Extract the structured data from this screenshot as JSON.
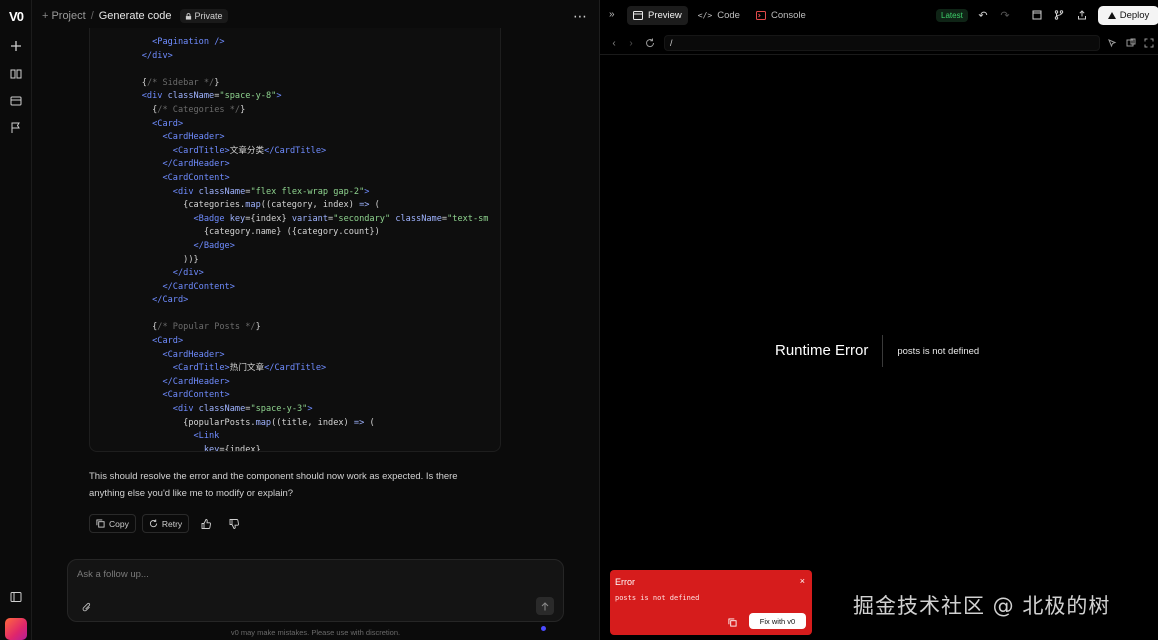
{
  "rail": {
    "logo": "V0",
    "icons": [
      "plus-icon",
      "book-icon",
      "folder-icon",
      "flag-icon",
      "sidebar-icon"
    ]
  },
  "header": {
    "project": "Project",
    "separator": "/",
    "title": "Generate code",
    "privacy": "Private",
    "more": "⋯"
  },
  "code_lines": [
    [
      [
        "            ",
        ""
      ],
      [
        "<",
        "tg"
      ],
      [
        "Pagination",
        "tg"
      ],
      [
        " />",
        "tg"
      ]
    ],
    [
      [
        "          ",
        ""
      ],
      [
        "</div>",
        "tg"
      ]
    ],
    [
      [
        "",
        ""
      ]
    ],
    [
      [
        "          ",
        ""
      ],
      [
        "{",
        ""
      ],
      [
        "/* Sidebar */",
        "cm"
      ],
      [
        "}",
        ""
      ]
    ],
    [
      [
        "          ",
        ""
      ],
      [
        "<div ",
        "tg"
      ],
      [
        "className",
        "at"
      ],
      [
        "=",
        ""
      ],
      [
        "\"space-y-8\"",
        "st"
      ],
      [
        ">",
        "tg"
      ]
    ],
    [
      [
        "            ",
        ""
      ],
      [
        "{",
        ""
      ],
      [
        "/* Categories */",
        "cm"
      ],
      [
        "}",
        ""
      ]
    ],
    [
      [
        "            ",
        ""
      ],
      [
        "<Card>",
        "tg"
      ]
    ],
    [
      [
        "              ",
        ""
      ],
      [
        "<CardHeader>",
        "tg"
      ]
    ],
    [
      [
        "                ",
        ""
      ],
      [
        "<CardTitle>",
        "tg"
      ],
      [
        "文章分类",
        ""
      ],
      [
        "</CardTitle>",
        "tg"
      ]
    ],
    [
      [
        "              ",
        ""
      ],
      [
        "</CardHeader>",
        "tg"
      ]
    ],
    [
      [
        "              ",
        ""
      ],
      [
        "<CardContent>",
        "tg"
      ]
    ],
    [
      [
        "                ",
        ""
      ],
      [
        "<div ",
        "tg"
      ],
      [
        "className",
        "at"
      ],
      [
        "=",
        ""
      ],
      [
        "\"flex flex-wrap gap-2\"",
        "st"
      ],
      [
        ">",
        "tg"
      ]
    ],
    [
      [
        "                  ",
        ""
      ],
      [
        "{categories.",
        ""
      ],
      [
        "map",
        "at"
      ],
      [
        "((category, index) ",
        ""
      ],
      [
        "=>",
        "at"
      ],
      [
        " (",
        ""
      ]
    ],
    [
      [
        "                    ",
        ""
      ],
      [
        "<Badge ",
        "tg"
      ],
      [
        "key",
        "at"
      ],
      [
        "={index} ",
        ""
      ],
      [
        "variant",
        "at"
      ],
      [
        "=",
        ""
      ],
      [
        "\"secondary\"",
        "st"
      ],
      [
        " ",
        ""
      ],
      [
        "className",
        "at"
      ],
      [
        "=",
        ""
      ],
      [
        "\"text-sm",
        "st"
      ]
    ],
    [
      [
        "                      ",
        ""
      ],
      [
        "{category.name} ({category.count})",
        ""
      ]
    ],
    [
      [
        "                    ",
        ""
      ],
      [
        "</Badge>",
        "tg"
      ]
    ],
    [
      [
        "                  ",
        ""
      ],
      [
        "))}",
        ""
      ]
    ],
    [
      [
        "                ",
        ""
      ],
      [
        "</div>",
        "tg"
      ]
    ],
    [
      [
        "              ",
        ""
      ],
      [
        "</CardContent>",
        "tg"
      ]
    ],
    [
      [
        "            ",
        ""
      ],
      [
        "</Card>",
        "tg"
      ]
    ],
    [
      [
        "",
        ""
      ]
    ],
    [
      [
        "            ",
        ""
      ],
      [
        "{",
        ""
      ],
      [
        "/* Popular Posts */",
        "cm"
      ],
      [
        "}",
        ""
      ]
    ],
    [
      [
        "            ",
        ""
      ],
      [
        "<Card>",
        "tg"
      ]
    ],
    [
      [
        "              ",
        ""
      ],
      [
        "<CardHeader>",
        "tg"
      ]
    ],
    [
      [
        "                ",
        ""
      ],
      [
        "<CardTitle>",
        "tg"
      ],
      [
        "热门文章",
        ""
      ],
      [
        "</CardTitle>",
        "tg"
      ]
    ],
    [
      [
        "              ",
        ""
      ],
      [
        "</CardHeader>",
        "tg"
      ]
    ],
    [
      [
        "              ",
        ""
      ],
      [
        "<CardContent>",
        "tg"
      ]
    ],
    [
      [
        "                ",
        ""
      ],
      [
        "<div ",
        "tg"
      ],
      [
        "className",
        "at"
      ],
      [
        "=",
        ""
      ],
      [
        "\"space-y-3\"",
        "st"
      ],
      [
        ">",
        "tg"
      ]
    ],
    [
      [
        "                  ",
        ""
      ],
      [
        "{popularPosts.",
        ""
      ],
      [
        "map",
        "at"
      ],
      [
        "((title, index) ",
        ""
      ],
      [
        "=>",
        "at"
      ],
      [
        " (",
        ""
      ]
    ],
    [
      [
        "                    ",
        ""
      ],
      [
        "<Link",
        "tg"
      ]
    ],
    [
      [
        "                      ",
        ""
      ],
      [
        "key",
        "at"
      ],
      [
        "={index}",
        ""
      ]
    ]
  ],
  "message": {
    "text": "This should resolve the error and the component should now work as expected. Is there anything else you'd like me to modify or explain?",
    "copy": "Copy",
    "retry": "Retry"
  },
  "composer": {
    "placeholder": "Ask a follow up...",
    "disclaimer": "v0 may make mistakes. Please use with discretion."
  },
  "preview": {
    "tabs": {
      "preview": "Preview",
      "code": "Code",
      "console": "Console"
    },
    "latest": "Latest",
    "deploy": "Deploy",
    "url": "/",
    "error_title": "Runtime Error",
    "error_message": "posts is not defined"
  },
  "toast": {
    "title": "Error",
    "close": "×",
    "message": "posts is not defined",
    "fix": "Fix with v0"
  },
  "watermark": "掘金技术社区 @ 北极的树",
  "colors": {
    "accent_red": "#d61c1c",
    "latest_green": "#3ecf6a"
  }
}
